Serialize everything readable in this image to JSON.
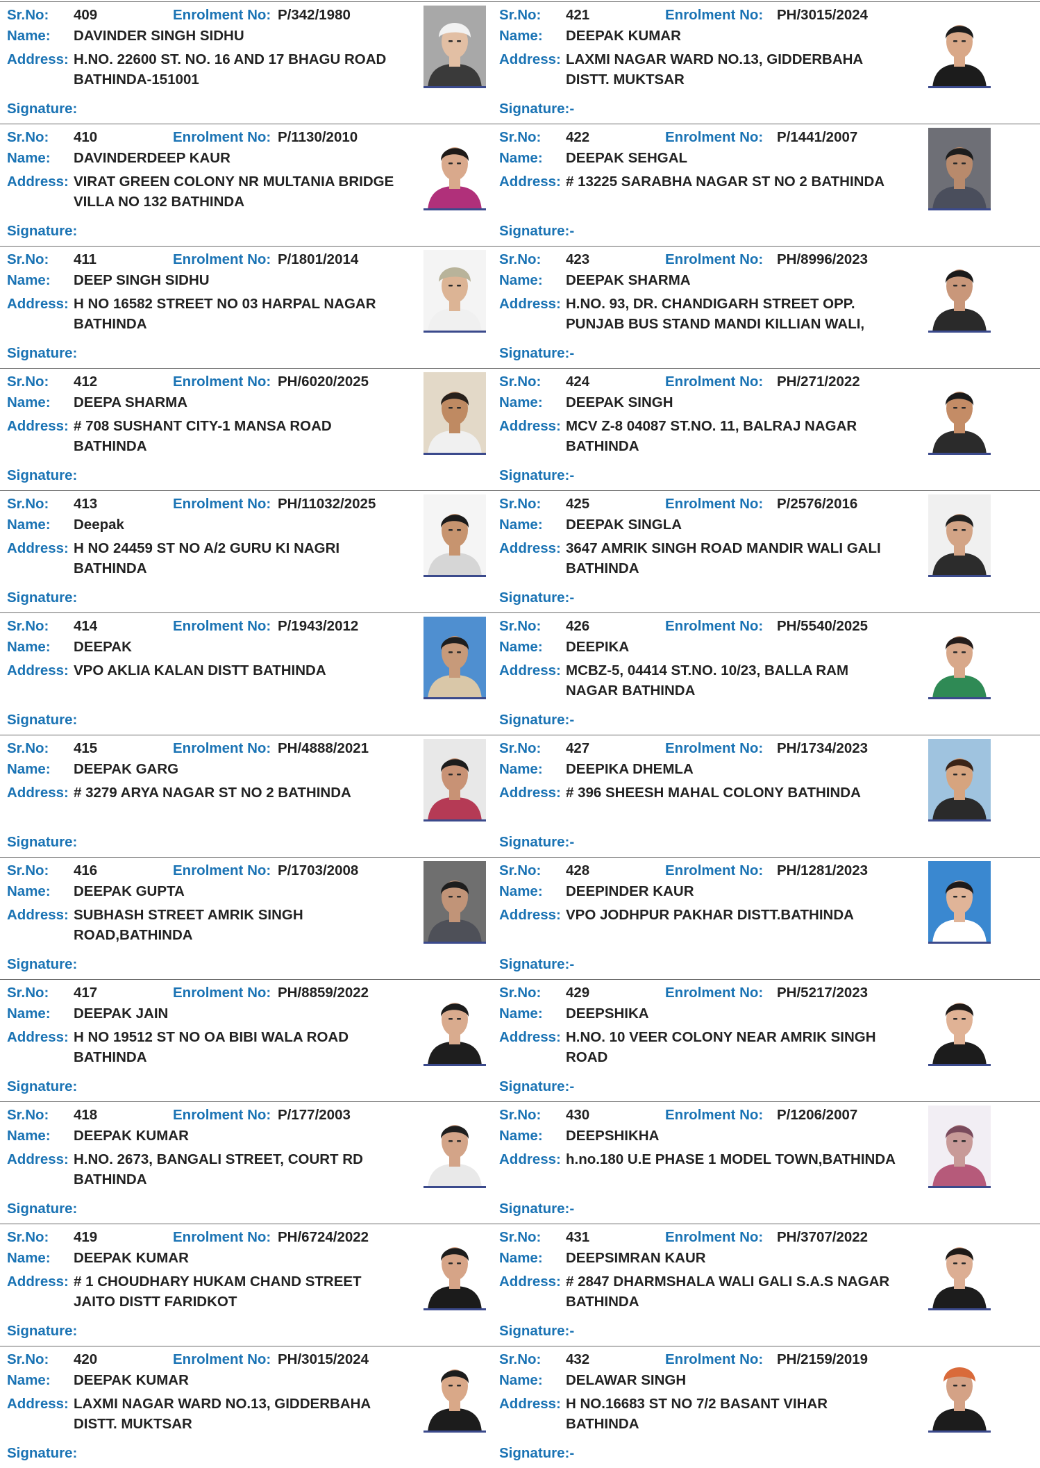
{
  "labels": {
    "sr_no": "Sr.No:",
    "name": "Name:",
    "address": "Address:",
    "enrolment": "Enrolment No:",
    "signature_left": "Signature:",
    "signature_right": "Signature:-"
  },
  "rows": [
    {
      "left": {
        "sr": "409",
        "enrolment": "P/342/1980",
        "name": "DAVINDER SINGH SIDHU",
        "address": "H.NO. 22600 ST. NO. 16 AND 17 BHAGU ROAD BATHINDA-151001",
        "photo": {
          "bg": "#a8a8a8",
          "skin": "#e2bfa4",
          "hair": "#f4f4f4",
          "shirt": "#3a3a3a",
          "turban": "#f2f2f2"
        }
      },
      "right": {
        "sr": "421",
        "enrolment": "PH/3015/2024",
        "name": "DEEPAK KUMAR",
        "address": "LAXMI NAGAR WARD NO.13, GIDDERBAHA DISTT. MUKTSAR",
        "photo": {
          "bg": "#ffffff",
          "skin": "#d9a888",
          "hair": "#1c1c1c",
          "shirt": "#1c1c1c"
        }
      }
    },
    {
      "left": {
        "sr": "410",
        "enrolment": "P/1130/2010",
        "name": "DAVINDERDEEP KAUR",
        "address": "VIRAT GREEN COLONY NR MULTANIA BRIDGE VILLA NO 132 BATHINDA",
        "photo": {
          "bg": "#ffffff",
          "skin": "#d9a98c",
          "hair": "#1e1a18",
          "shirt": "#b0307a"
        }
      },
      "right": {
        "sr": "422",
        "enrolment": "P/1441/2007",
        "name": "DEEPAK SEHGAL",
        "address": "# 13225 SARABHA NAGAR ST NO 2 BATHINDA",
        "photo": {
          "bg": "#6e6f76",
          "skin": "#b88a6c",
          "hair": "#1d1d1d",
          "shirt": "#4a4e5c"
        }
      }
    },
    {
      "left": {
        "sr": "411",
        "enrolment": "P/1801/2014",
        "name": "DEEP SINGH SIDHU",
        "address": "H NO 16582 STREET NO 03 HARPAL NAGAR BATHINDA",
        "photo": {
          "bg": "#f4f4f4",
          "skin": "#dcb495",
          "hair": "#2d2b2b",
          "shirt": "#f0f0f0",
          "turban": "#b8b39a"
        }
      },
      "right": {
        "sr": "423",
        "enrolment": "PH/8996/2023",
        "name": "DEEPAK SHARMA",
        "address": "H.NO. 93, DR. CHANDIGARH STREET OPP. PUNJAB BUS STAND MANDI KILLIAN WALI,",
        "photo": {
          "bg": "#ffffff",
          "skin": "#c9977a",
          "hair": "#1a1a1a",
          "shirt": "#2a2a2a"
        }
      }
    },
    {
      "left": {
        "sr": "412",
        "enrolment": "PH/6020/2025",
        "name": "DEEPA SHARMA",
        "address": "# 708 SUSHANT CITY-1 MANSA ROAD BATHINDA",
        "photo": {
          "bg": "#e3d9c8",
          "skin": "#bf8a62",
          "hair": "#27201b",
          "shirt": "#f0f0f0"
        }
      },
      "right": {
        "sr": "424",
        "enrolment": "PH/271/2022",
        "name": "DEEPAK SINGH",
        "address": "MCV Z-8  04087 ST.NO. 11, BALRAJ NAGAR BATHINDA",
        "photo": {
          "bg": "#ffffff",
          "skin": "#c48c66",
          "hair": "#1a1a1a",
          "shirt": "#2b2b2b"
        }
      }
    },
    {
      "left": {
        "sr": "413",
        "enrolment": "PH/11032/2025",
        "name": "Deepak",
        "address": "H NO 24459 ST NO A/2 GURU KI NAGRI BATHINDA",
        "photo": {
          "bg": "#f5f5f5",
          "skin": "#c7946f",
          "hair": "#1b1b1b",
          "shirt": "#d6d6d6"
        }
      },
      "right": {
        "sr": "425",
        "enrolment": "P/2576/2016",
        "name": "DEEPAK SINGLA",
        "address": "3647 AMRIK SINGH ROAD MANDIR WALI GALI BATHINDA",
        "photo": {
          "bg": "#f0f0f0",
          "skin": "#d3a486",
          "hair": "#202020",
          "shirt": "#2c2c2c"
        }
      }
    },
    {
      "left": {
        "sr": "414",
        "enrolment": "P/1943/2012",
        "name": "DEEPAK",
        "address": "VPO AKLIA KALAN DISTT BATHINDA",
        "photo": {
          "bg": "#4f8fd0",
          "skin": "#c79a7a",
          "hair": "#1e1e1e",
          "shirt": "#d9c7a8"
        }
      },
      "right": {
        "sr": "426",
        "enrolment": "PH/5540/2025",
        "name": "DEEPIKA",
        "address": "MCBZ-5, 04414 ST.NO. 10/23, BALLA RAM NAGAR BATHINDA",
        "photo": {
          "bg": "#ffffff",
          "skin": "#d8a88a",
          "hair": "#241c1a",
          "shirt": "#2f8a55"
        }
      }
    },
    {
      "left": {
        "sr": "415",
        "enrolment": "PH/4888/2021",
        "name": "DEEPAK GARG",
        "address": "# 3279 ARYA NAGAR ST NO 2 BATHINDA",
        "photo": {
          "bg": "#e8e8e8",
          "skin": "#c89275",
          "hair": "#1c1c1c",
          "shirt": "#b53a55"
        }
      },
      "right": {
        "sr": "427",
        "enrolment": "PH/1734/2023",
        "name": "DEEPIKA DHEMLA",
        "address": "# 396 SHEESH MAHAL COLONY BATHINDA",
        "photo": {
          "bg": "#9fc3df",
          "skin": "#d6a47f",
          "hair": "#3a2418",
          "shirt": "#2a2a2a"
        }
      }
    },
    {
      "left": {
        "sr": "416",
        "enrolment": "P/1703/2008",
        "name": "DEEPAK GUPTA",
        "address": "SUBHASH STREET AMRIK SINGH ROAD,BATHINDA",
        "photo": {
          "bg": "#6f6f6f",
          "skin": "#c19478",
          "hair": "#1d1d1d",
          "shirt": "#4e5058"
        }
      },
      "right": {
        "sr": "428",
        "enrolment": "PH/1281/2023",
        "name": "DEEPINDER  KAUR",
        "address": "VPO JODHPUR  PAKHAR DISTT.BATHINDA",
        "photo": {
          "bg": "#3a88d0",
          "skin": "#e0b498",
          "hair": "#1e1a1a",
          "shirt": "#ffffff"
        }
      }
    },
    {
      "left": {
        "sr": "417",
        "enrolment": "PH/8859/2022",
        "name": "DEEPAK JAIN",
        "address": "H NO 19512 ST NO OA BIBI WALA ROAD BATHINDA",
        "photo": {
          "bg": "#ffffff",
          "skin": "#d9ab8e",
          "hair": "#1c1c1c",
          "shirt": "#1e1e1e"
        }
      },
      "right": {
        "sr": "429",
        "enrolment": "PH/5217/2023",
        "name": "DEEPSHIKA",
        "address": "H.NO. 10 VEER COLONY NEAR AMRIK SINGH ROAD",
        "photo": {
          "bg": "#ffffff",
          "skin": "#e0b295",
          "hair": "#1f1a18",
          "shirt": "#1c1c1c"
        }
      }
    },
    {
      "left": {
        "sr": "418",
        "enrolment": "P/177/2003",
        "name": "DEEPAK KUMAR",
        "address": "H.NO. 2673, BANGALI STREET,  COURT RD BATHINDA",
        "photo": {
          "bg": "#ffffff",
          "skin": "#d3a488",
          "hair": "#1e1e1e",
          "shirt": "#e9e9e9"
        }
      },
      "right": {
        "sr": "430",
        "enrolment": "P/1206/2007",
        "name": "DEEPSHIKHA",
        "address": "h.no.180 U.E PHASE 1 MODEL TOWN,BATHINDA",
        "photo": {
          "bg": "#f2eef4",
          "skin": "#c89a98",
          "hair": "#7a4a5c",
          "shirt": "#b65a7a"
        }
      }
    },
    {
      "left": {
        "sr": "419",
        "enrolment": "PH/6724/2022",
        "name": "DEEPAK KUMAR",
        "address": "# 1 CHOUDHARY HUKAM CHAND STREET JAITO DISTT FARIDKOT",
        "photo": {
          "bg": "#ffffff",
          "skin": "#d6a487",
          "hair": "#1c1c1c",
          "shirt": "#1b1b1b"
        }
      },
      "right": {
        "sr": "431",
        "enrolment": "PH/3707/2022",
        "name": "DEEPSIMRAN KAUR",
        "address": "# 2847 DHARMSHALA WALI GALI S.A.S NAGAR BATHINDA",
        "photo": {
          "bg": "#ffffff",
          "skin": "#dcae93",
          "hair": "#1f1a18",
          "shirt": "#1c1c1c"
        }
      }
    },
    {
      "left": {
        "sr": "420",
        "enrolment": "PH/3015/2024",
        "name": "DEEPAK KUMAR",
        "address": "LAXMI NAGAR WARD NO.13, GIDDERBAHA DISTT. MUKTSAR",
        "photo": {
          "bg": "#ffffff",
          "skin": "#d9a888",
          "hair": "#1c1c1c",
          "shirt": "#1c1c1c"
        }
      },
      "right": {
        "sr": "432",
        "enrolment": "PH/2159/2019",
        "name": "DELAWAR SINGH",
        "address": "H NO.16683 ST NO 7/2 BASANT VIHAR BATHINDA",
        "photo": {
          "bg": "#ffffff",
          "skin": "#d4a286",
          "hair": "#1c1c1c",
          "shirt": "#1c1c1c",
          "turban": "#d96a3a"
        }
      }
    }
  ]
}
